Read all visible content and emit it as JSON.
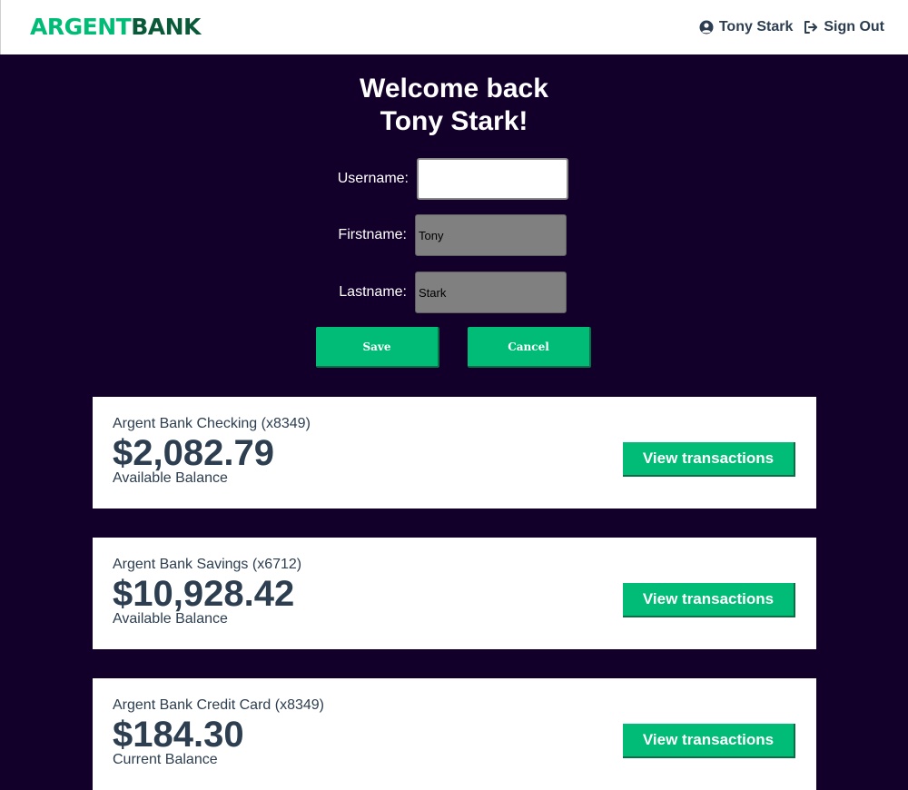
{
  "brand": {
    "part1": "ARGENT",
    "part2": "BANK"
  },
  "nav": {
    "user_name": "Tony Stark",
    "sign_out": "Sign Out"
  },
  "welcome": {
    "line1": "Welcome back",
    "line2": "Tony Stark!"
  },
  "form": {
    "username_label": "Username:",
    "username_value": "",
    "firstname_label": "Firstname:",
    "firstname_value": "Tony",
    "lastname_label": "Lastname:",
    "lastname_value": "Stark",
    "save_label": "Save",
    "cancel_label": "Cancel"
  },
  "accounts": [
    {
      "title": "Argent Bank Checking (x8349)",
      "amount": "$2,082.79",
      "description": "Available Balance",
      "button": "View transactions"
    },
    {
      "title": "Argent Bank Savings (x6712)",
      "amount": "$10,928.42",
      "description": "Available Balance",
      "button": "View transactions"
    },
    {
      "title": "Argent Bank Credit Card (x8349)",
      "amount": "$184.30",
      "description": "Current Balance",
      "button": "View transactions"
    }
  ],
  "colors": {
    "accent": "#00bc77",
    "background": "#12002b",
    "text_dark": "#2c3e50"
  },
  "icons": {
    "user": "user-circle-icon",
    "sign_out": "sign-out-icon"
  }
}
